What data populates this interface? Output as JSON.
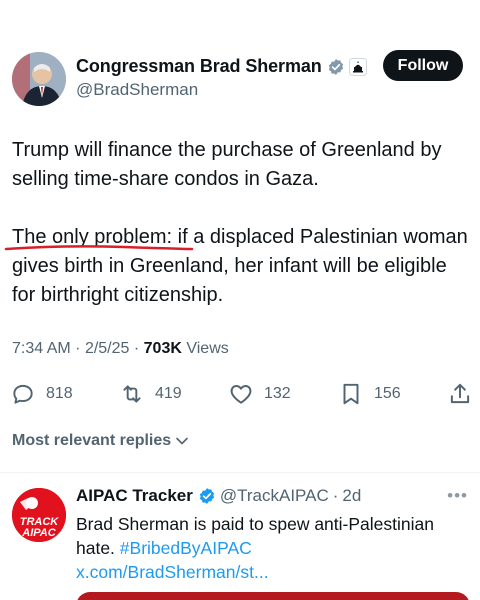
{
  "author": {
    "display_name": "Congressman Brad Sherman",
    "handle": "@BradSherman",
    "verified_icon": "verified-badge-icon",
    "affiliation_icon": "us-government-capitol-icon",
    "follow_label": "Follow"
  },
  "tweet": {
    "paragraph_1": "Trump will finance the purchase of Greenland by selling time-share condos in Gaza.",
    "paragraph_2": "The only problem: if a displaced Palestinian woman gives birth in Greenland, her infant will be eligible for birthright citizenship.",
    "time": "7:34 AM",
    "date": "2/5/25",
    "views_count": "703K",
    "views_label": "Views"
  },
  "actions": {
    "replies": "818",
    "reposts": "419",
    "likes": "132",
    "bookmarks": "156"
  },
  "replies_section": {
    "sort_label": "Most relevant replies"
  },
  "reply": {
    "display_name": "AIPAC Tracker",
    "handle": "@TrackAIPAC",
    "age": "2d",
    "text_plain": "Brad Sherman is paid to spew anti-Palestinian hate. ",
    "hashtag": "#BribedByAIPAC",
    "link": "x.com/BradSherman/st...",
    "avatar_text_1": "TRACK",
    "avatar_text_2": "AIPAC"
  },
  "colors": {
    "accent": "#1d9bf0",
    "text_primary": "#0f1419",
    "text_secondary": "#536471",
    "annotation_red": "#d8202a"
  }
}
